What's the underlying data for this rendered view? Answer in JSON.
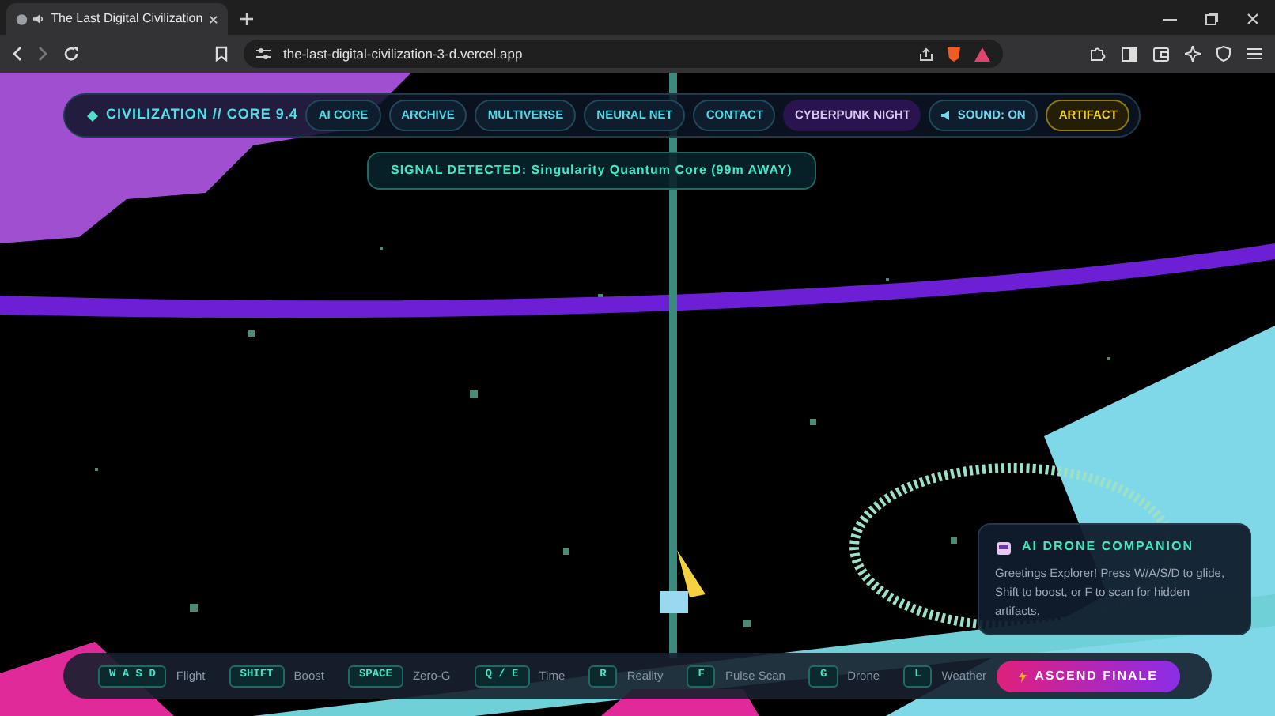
{
  "browser": {
    "tab_title": "The Last Digital Civilization",
    "url": "the-last-digital-civilization-3-d.vercel.app"
  },
  "nav": {
    "brand": "CIVILIZATION // CORE 9.4",
    "items": [
      {
        "label": "AI CORE",
        "kind": "link"
      },
      {
        "label": "ARCHIVE",
        "kind": "link"
      },
      {
        "label": "MULTIVERSE",
        "kind": "link"
      },
      {
        "label": "NEURAL NET",
        "kind": "link"
      },
      {
        "label": "CONTACT",
        "kind": "link"
      },
      {
        "label": "CYBERPUNK NIGHT",
        "kind": "theme"
      },
      {
        "label": "SOUND: ON",
        "kind": "sound"
      },
      {
        "label": "ARTIFACT",
        "kind": "artifact"
      }
    ]
  },
  "signal": "SIGNAL DETECTED: Singularity Quantum Core (99m AWAY)",
  "drone": {
    "title": "AI DRONE COMPANION",
    "message": "Greetings Explorer! Press W/A/S/D to glide, Shift to boost, or F to scan for hidden artifacts."
  },
  "controls": [
    {
      "key": "W A S D",
      "label": "Flight"
    },
    {
      "key": "SHIFT",
      "label": "Boost"
    },
    {
      "key": "SPACE",
      "label": "Zero-G"
    },
    {
      "key": "Q / E",
      "label": "Time"
    },
    {
      "key": "R",
      "label": "Reality"
    },
    {
      "key": "F",
      "label": "Pulse Scan"
    },
    {
      "key": "G",
      "label": "Drone"
    },
    {
      "key": "L",
      "label": "Weather"
    }
  ],
  "finale": {
    "label": "ASCEND FINALE"
  }
}
